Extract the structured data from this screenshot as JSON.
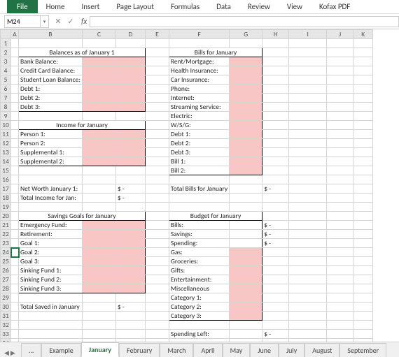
{
  "ribbon": [
    "File",
    "Home",
    "Insert",
    "Page Layout",
    "Formulas",
    "Data",
    "Review",
    "View",
    "Kofax PDF"
  ],
  "namebox": "M24",
  "cols": [
    "A",
    "B",
    "C",
    "D",
    "E",
    "F",
    "G",
    "H",
    "I",
    "J",
    "K"
  ],
  "section_titles": {
    "balances": "Balances as of January 1",
    "income": "Income for January",
    "savings": "Savings Goals for January",
    "bills": "Bills for January",
    "budget": "Budget for January"
  },
  "balances_labels": [
    "Bank Balance:",
    "Credit Card Balance:",
    "Student Loan Balance:",
    "Debt 1:",
    "Debt 2:",
    "Debt 3:"
  ],
  "income_labels": [
    "Person 1:",
    "Person 2:",
    "Supplemental 1:",
    "Supplemental 2:"
  ],
  "bills_labels": [
    "Rent/Mortgage:",
    "Health Insurance:",
    "Car Insurance:",
    "Phone:",
    "Internet:",
    "Streaming Service:",
    "Electric:",
    "W/S/G:",
    "Debt 1:",
    "Debt 2:",
    "Debt 3:",
    "Bill 1:",
    "Bill 2:"
  ],
  "savings_labels": [
    "Emergency Fund:",
    "Retirement:",
    "Goal 1:",
    "Goal 2:",
    "Goal 3:",
    "Sinking Fund 1:",
    "Sinking Fund 2:",
    "Sinking Fund 3:"
  ],
  "budget_labels": [
    "Bills:",
    "Savings:",
    "Spending:",
    "  Gas:",
    "  Groceries:",
    "  Gifts:",
    "  Entertainment:",
    "  Miscellaneous",
    "  Category 1:",
    "  Category 2:",
    "  Category 3:"
  ],
  "summaries": {
    "networth": "Net Worth January 1:",
    "totalincome": "Total Income for Jan:",
    "totalbills": "Total Bills for January",
    "totalsaved": "Total Saved in January",
    "spendingleft": "Spending Left:"
  },
  "amount": {
    "dollar": "$",
    "dash": "-"
  },
  "sheets": [
    "...",
    "Example",
    "January",
    "February",
    "March",
    "April",
    "May",
    "June",
    "July",
    "August",
    "September"
  ],
  "active_sheet": "January",
  "chart_data": null
}
